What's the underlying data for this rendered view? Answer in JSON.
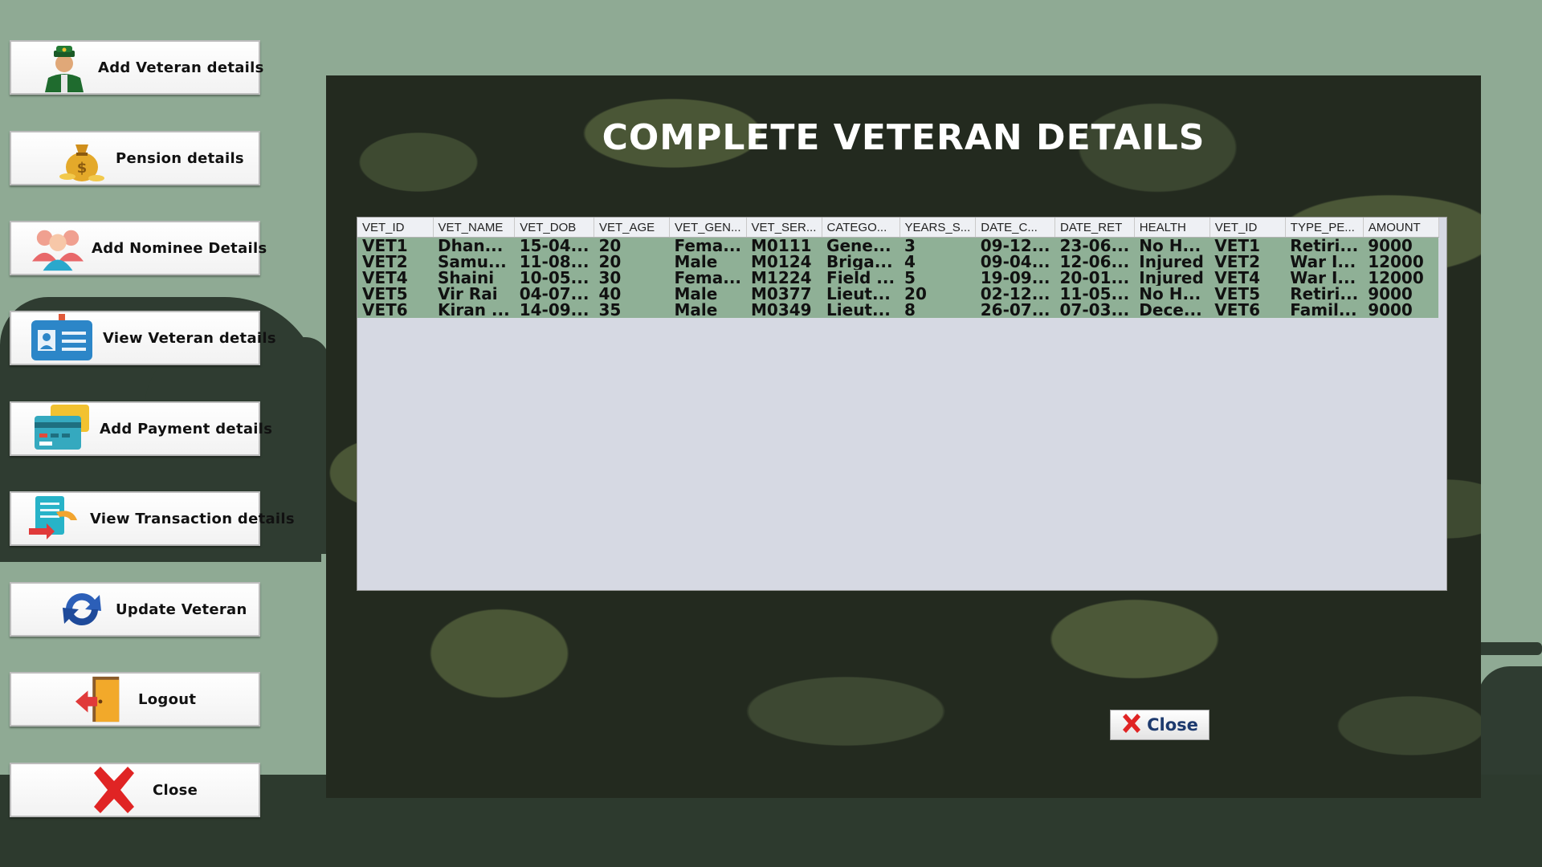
{
  "sidebar": {
    "items": [
      {
        "label": "Add Veteran details",
        "icon": "soldier-icon"
      },
      {
        "label": "Pension details",
        "icon": "money-bag-icon"
      },
      {
        "label": "Add Nominee Details",
        "icon": "people-icon"
      },
      {
        "label": "View Veteran details",
        "icon": "id-card-icon"
      },
      {
        "label": "Add Payment details",
        "icon": "credit-card-icon"
      },
      {
        "label": "View Transaction details",
        "icon": "document-transfer-icon"
      },
      {
        "label": "Update Veteran",
        "icon": "refresh-icon"
      },
      {
        "label": "Logout",
        "icon": "exit-door-icon"
      },
      {
        "label": "Close",
        "icon": "close-x-icon"
      }
    ]
  },
  "panel": {
    "title": "COMPLETE VETERAN DETAILS",
    "close_label": "Close"
  },
  "table": {
    "columns": [
      "VET_ID",
      "VET_NAME",
      "VET_DOB",
      "VET_AGE",
      "VET_GEN...",
      "VET_SER...",
      "CATEGO...",
      "YEARS_S...",
      "DATE_C...",
      "DATE_RET",
      "HEALTH",
      "VET_ID",
      "TYPE_PE...",
      "AMOUNT"
    ],
    "rows": [
      [
        "VET1",
        "Dhan...",
        "15-04...",
        "20",
        "Fema...",
        "M0111",
        "Gene...",
        "3",
        "09-12...",
        "23-06...",
        "No H...",
        "VET1",
        "Retiri...",
        "9000"
      ],
      [
        "VET2",
        "Samu...",
        "11-08...",
        "20",
        "Male",
        "M0124",
        "Briga...",
        "4",
        "09-04...",
        "12-06...",
        "Injured",
        "VET2",
        "War I...",
        "12000"
      ],
      [
        "VET4",
        "Shaini",
        "10-05...",
        "30",
        "Fema...",
        "M1224",
        "Field ...",
        "5",
        "19-09...",
        "20-01...",
        "Injured",
        "VET4",
        "War I...",
        "12000"
      ],
      [
        "VET5",
        "Vir Rai",
        "04-07...",
        "40",
        "Male",
        "M0377",
        "Lieut...",
        "20",
        "02-12...",
        "11-05...",
        "No H...",
        "VET5",
        "Retiri...",
        "9000"
      ],
      [
        "VET6",
        "Kiran ...",
        "14-09...",
        "35",
        "Male",
        "M0349",
        "Lieut...",
        "8",
        "26-07...",
        "07-03...",
        "Dece...",
        "VET6",
        "Famil...",
        "9000"
      ]
    ]
  },
  "colors": {
    "background": "#8faa94",
    "panel_dark": "#232a1f",
    "row_green": "#8fb096",
    "close_x": "#e02424"
  }
}
